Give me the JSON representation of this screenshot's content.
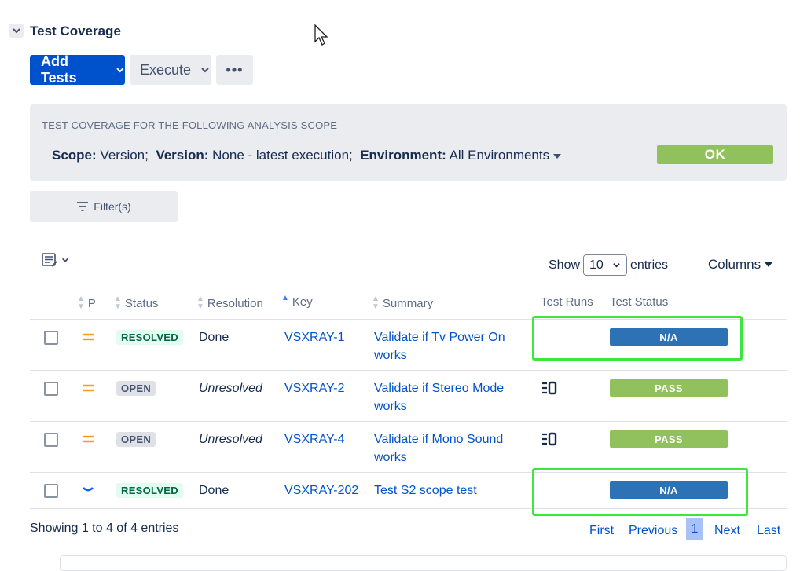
{
  "section": {
    "title": "Test Coverage"
  },
  "toolbar": {
    "add_tests_label": "Add Tests",
    "execute_label": "Execute",
    "more_label": "•••"
  },
  "scope": {
    "heading": "TEST COVERAGE FOR THE FOLLOWING ANALYSIS SCOPE",
    "scope_key": "Scope:",
    "scope_value": "Version;",
    "version_key": "Version:",
    "version_value": "None - latest execution;",
    "environment_key": "Environment:",
    "environment_value": "All Environments",
    "status": "OK",
    "status_color": "#91c15c"
  },
  "filter": {
    "label": "Filter(s)"
  },
  "table_controls": {
    "show_label": "Show",
    "entries_value": "10",
    "entries_label": "entries",
    "columns_label": "Columns"
  },
  "columns": {
    "priority": "P",
    "status": "Status",
    "resolution": "Resolution",
    "key": "Key",
    "summary": "Summary",
    "test_runs": "Test Runs",
    "test_status": "Test Status"
  },
  "rows": [
    {
      "priority_icon": "medium-priority-icon",
      "status": "RESOLVED",
      "resolution": "Done",
      "key": "VSXRAY-1",
      "summary": "Validate if Tv Power On works",
      "has_runs": false,
      "test_status": "N/A",
      "test_status_color": "#2d72b5"
    },
    {
      "priority_icon": "medium-priority-icon",
      "status": "OPEN",
      "resolution": "Unresolved",
      "key": "VSXRAY-2",
      "summary": "Validate if Stereo Mode works",
      "has_runs": true,
      "test_status": "PASS",
      "test_status_color": "#91c15c"
    },
    {
      "priority_icon": "medium-priority-icon",
      "status": "OPEN",
      "resolution": "Unresolved",
      "key": "VSXRAY-4",
      "summary": "Validate if Mono Sound works",
      "has_runs": true,
      "test_status": "PASS",
      "test_status_color": "#91c15c"
    },
    {
      "priority_icon": "low-priority-icon",
      "status": "RESOLVED",
      "resolution": "Done",
      "key": "VSXRAY-202",
      "summary": "Test S2 scope test",
      "has_runs": false,
      "test_status": "N/A",
      "test_status_color": "#2d72b5"
    }
  ],
  "footer": {
    "showing_text": "Showing 1 to 4 of 4 entries",
    "first": "First",
    "previous": "Previous",
    "current_page": "1",
    "next": "Next",
    "last": "Last"
  },
  "colors": {
    "primary": "#0052cc",
    "highlight": "#3ce63c",
    "priority_medium": "#ff991f",
    "priority_low": "#0065ff"
  }
}
